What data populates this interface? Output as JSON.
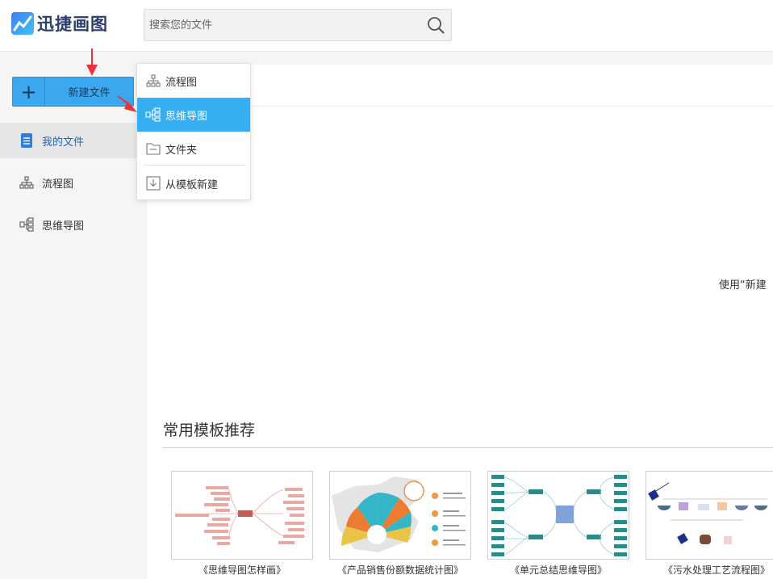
{
  "app": {
    "name": "迅捷画图",
    "logo_icon": "chart-line-icon"
  },
  "search": {
    "placeholder": "搜索您的文件",
    "icon": "search-icon"
  },
  "sidebar": {
    "new_button_label": "新建文件",
    "items": [
      {
        "label": "我的文件",
        "icon": "document-icon",
        "active": true
      },
      {
        "label": "流程图",
        "icon": "flowchart-icon",
        "active": false
      },
      {
        "label": "思维导图",
        "icon": "mindmap-icon",
        "active": false
      }
    ]
  },
  "dropdown": {
    "items": [
      {
        "label": "流程图",
        "icon": "flowchart-icon",
        "active": false
      },
      {
        "label": "思维导图",
        "icon": "mindmap-icon",
        "active": true
      },
      {
        "label": "文件夹",
        "icon": "folder-icon",
        "active": false
      },
      {
        "label": "从模板新建",
        "icon": "template-import-icon",
        "active": false
      }
    ]
  },
  "main": {
    "empty_hint": "使用“新建",
    "templates_title": "常用模板推荐",
    "templates": [
      {
        "caption": "《思维导图怎样画》"
      },
      {
        "caption": "《产品销售份额数据统计图》"
      },
      {
        "caption": "《单元总结思维导图》"
      },
      {
        "caption": "《污水处理工艺流程图》"
      }
    ]
  },
  "colors": {
    "accent": "#35aef2",
    "annotation_arrow": "#e8323c"
  }
}
